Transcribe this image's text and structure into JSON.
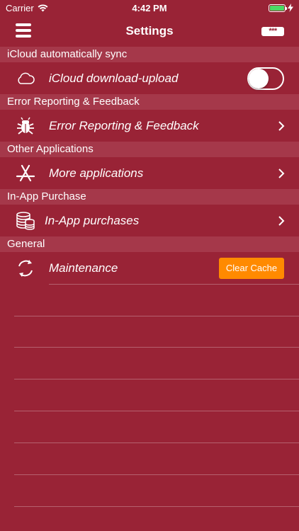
{
  "status_bar": {
    "carrier": "Carrier",
    "time": "4:42 PM"
  },
  "navbar": {
    "title": "Settings",
    "right_icon": "password-icon",
    "right_icon_text": "***"
  },
  "sections": [
    {
      "header": "iCloud automatically sync",
      "label": "iCloud download-upload",
      "icon": "cloud-icon",
      "accessory": "toggle",
      "toggle_on": false
    },
    {
      "header": "Error Reporting & Feedback",
      "label": "Error Reporting & Feedback",
      "icon": "bug-icon",
      "accessory": "chevron"
    },
    {
      "header": "Other Applications",
      "label": "More applications",
      "icon": "app-store-icon",
      "accessory": "chevron"
    },
    {
      "header": "In-App Purchase",
      "label": "In-App purchases",
      "icon": "coins-icon",
      "accessory": "chevron"
    },
    {
      "header": "General",
      "label": "Maintenance",
      "icon": "refresh-icon",
      "accessory": "button",
      "button_label": "Clear Cache"
    }
  ],
  "colors": {
    "background": "#992336",
    "section_header": "#a5384a",
    "button": "#ff8a00",
    "battery": "#4cd964"
  }
}
